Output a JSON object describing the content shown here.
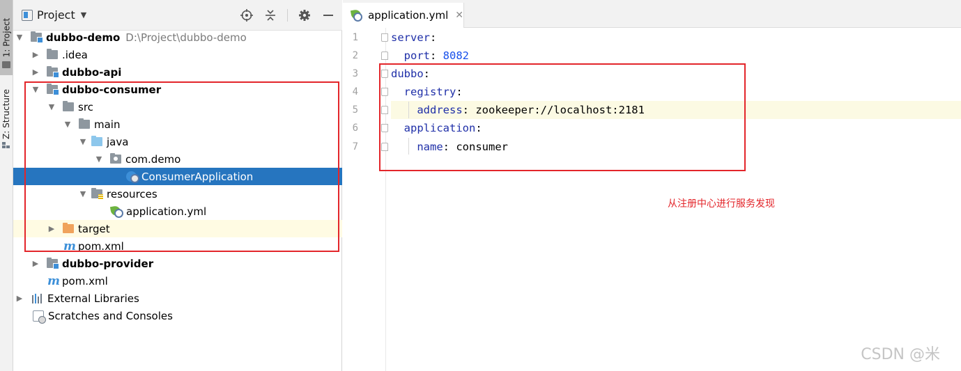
{
  "tool_strip": {
    "project_tab": "1: Project",
    "structure_tab": "Z: Structure"
  },
  "project_panel": {
    "title": "Project",
    "tree": [
      {
        "label": "dubbo-demo",
        "path": "D:\\Project\\dubbo-demo",
        "bold": true,
        "icon": "module-folder-icon",
        "arrow": "down"
      },
      {
        "label": ".idea",
        "icon": "folder-icon",
        "arrow": "right"
      },
      {
        "label": "dubbo-api",
        "bold": true,
        "icon": "module-folder-icon",
        "arrow": "right"
      },
      {
        "label": "dubbo-consumer",
        "bold": true,
        "icon": "module-folder-icon",
        "arrow": "down"
      },
      {
        "label": "src",
        "icon": "folder-icon",
        "arrow": "down"
      },
      {
        "label": "main",
        "icon": "folder-icon",
        "arrow": "down"
      },
      {
        "label": "java",
        "icon": "source-folder-icon",
        "arrow": "down"
      },
      {
        "label": "com.demo",
        "icon": "package-icon",
        "arrow": "down"
      },
      {
        "label": "ConsumerApplication",
        "icon": "spring-class-icon",
        "selected": true
      },
      {
        "label": "resources",
        "icon": "resources-folder-icon",
        "arrow": "down"
      },
      {
        "label": "application.yml",
        "icon": "spring-config-icon"
      },
      {
        "label": "target",
        "icon": "excluded-folder-icon",
        "arrow": "right"
      },
      {
        "label": "pom.xml",
        "icon": "maven-icon"
      },
      {
        "label": "dubbo-provider",
        "bold": true,
        "icon": "module-folder-icon",
        "arrow": "right"
      },
      {
        "label": "pom.xml",
        "icon": "maven-icon"
      },
      {
        "label": "External Libraries",
        "icon": "library-icon",
        "arrow": "right"
      },
      {
        "label": "Scratches and Consoles",
        "icon": "scratches-icon"
      }
    ]
  },
  "editor": {
    "tab_label": "application.yml",
    "close_glyph": "✕",
    "lines": [
      {
        "n": "1",
        "key": "server",
        "sep": ":",
        "value": ""
      },
      {
        "n": "2",
        "key": "port",
        "sep": ": ",
        "value": "8082",
        "value_type": "number"
      },
      {
        "n": "3",
        "key": "dubbo",
        "sep": ":",
        "value": ""
      },
      {
        "n": "4",
        "key": "registry",
        "sep": ":",
        "value": ""
      },
      {
        "n": "5",
        "key": "address",
        "sep": ": ",
        "value": "zookeeper://localhost:2181"
      },
      {
        "n": "6",
        "key": "application",
        "sep": ":",
        "value": ""
      },
      {
        "n": "7",
        "key": "name",
        "sep": ": ",
        "value": "consumer"
      }
    ],
    "annotation": "从注册中心进行服务发现"
  },
  "watermark": "CSDN @米",
  "colors": {
    "selection": "#2675bf",
    "annotation_red": "#e3252a",
    "yaml_key": "#1f2fa8",
    "yaml_number": "#1750eb"
  }
}
